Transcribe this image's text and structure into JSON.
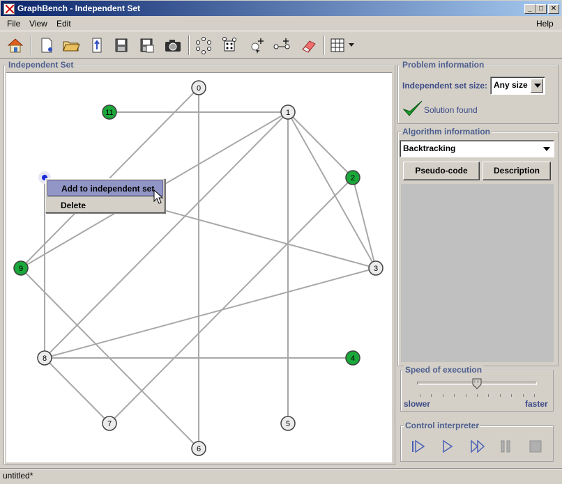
{
  "window": {
    "title": "GraphBench - Independent Set"
  },
  "menu": {
    "file": "File",
    "view": "View",
    "edit": "Edit",
    "help": "Help"
  },
  "toolbar": {
    "items": [
      "home-icon",
      "new-graph-icon",
      "open-folder-icon",
      "import-icon",
      "save-icon",
      "save-as-icon",
      "camera-icon",
      "circle-layout-icon",
      "random-graph-icon",
      "add-vertex-icon",
      "add-edge-icon",
      "eraser-icon",
      "grid-icon"
    ]
  },
  "graph_panel": {
    "title": "Independent Set",
    "vertices": [
      {
        "id": "0",
        "label": "0",
        "color": "#ebebeb",
        "in_set": false
      },
      {
        "id": "1",
        "label": "1",
        "color": "#ebebeb",
        "in_set": false
      },
      {
        "id": "2",
        "label": "2",
        "color": "#1aa83a",
        "in_set": true
      },
      {
        "id": "3",
        "label": "3",
        "color": "#ebebeb",
        "in_set": false
      },
      {
        "id": "4",
        "label": "4",
        "color": "#1aa83a",
        "in_set": true
      },
      {
        "id": "5",
        "label": "5",
        "color": "#ebebeb",
        "in_set": false
      },
      {
        "id": "6",
        "label": "6",
        "color": "#ebebeb",
        "in_set": false
      },
      {
        "id": "7",
        "label": "7",
        "color": "#ebebeb",
        "in_set": false
      },
      {
        "id": "8",
        "label": "8",
        "color": "#ebebeb",
        "in_set": false
      },
      {
        "id": "9",
        "label": "9",
        "color": "#1aa83a",
        "in_set": true
      },
      {
        "id": "10",
        "label": "",
        "color": "#1a2bd6",
        "in_set": false
      },
      {
        "id": "11",
        "label": "11",
        "color": "#1aa83a",
        "in_set": true
      }
    ],
    "edges": [
      [
        "11",
        "1"
      ],
      [
        "0",
        "6"
      ],
      [
        "0",
        "9"
      ],
      [
        "1",
        "5"
      ],
      [
        "1",
        "2"
      ],
      [
        "1",
        "3"
      ],
      [
        "1",
        "9"
      ],
      [
        "1",
        "8"
      ],
      [
        "2",
        "3"
      ],
      [
        "2",
        "7"
      ],
      [
        "3",
        "8"
      ],
      [
        "8",
        "4"
      ],
      [
        "8",
        "7"
      ],
      [
        "9",
        "6"
      ],
      [
        "10",
        "8"
      ],
      [
        "10",
        "3"
      ]
    ]
  },
  "context_menu": {
    "add": "Add to independent set",
    "delete": "Delete"
  },
  "problem_info": {
    "title": "Problem information",
    "size_label": "Independent set size:",
    "size_value": "Any size",
    "solution_text": "Solution found"
  },
  "algorithm_info": {
    "title": "Algorithm information",
    "algorithm": "Backtracking",
    "pseudo_code": "Pseudo-code",
    "description": "Description"
  },
  "speed": {
    "title": "Speed of execution",
    "slower": "slower",
    "faster": "faster",
    "level": 0.5
  },
  "control": {
    "title": "Control interpreter"
  },
  "status": {
    "text": "untitled*"
  }
}
